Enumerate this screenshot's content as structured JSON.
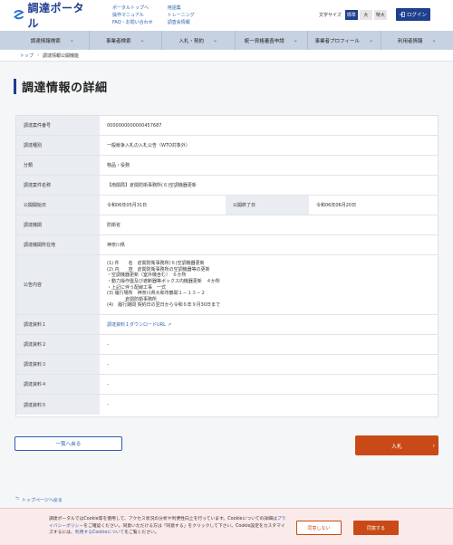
{
  "header": {
    "logo_text": "調達ポータル",
    "links_col1": [
      "ポータルトップへ",
      "操作マニュアル",
      "FAQ・お問い合わせ"
    ],
    "links_col2": [
      "用語集",
      "トレーニング",
      "調査会情報"
    ],
    "font_size_label": "文字サイズ",
    "font_sizes": [
      "標準",
      "大",
      "特大"
    ],
    "login_label": "ログイン"
  },
  "nav": {
    "items": [
      "調達情報検索",
      "事業者検索",
      "入札・契約",
      "統一資格審査申請",
      "事業者プロフィール",
      "利用者情報"
    ]
  },
  "breadcrumb": {
    "home": "トップ",
    "current": "調達情報公開機能"
  },
  "page_title": "調達情報の詳細",
  "detail": {
    "case_number_label": "調達案件番号",
    "case_number": "0000000000000457687",
    "type_label": "調達種別",
    "type": "一般競争入札の入札公告（WTO対象外）",
    "category_label": "分類",
    "category": "物品・役務",
    "name_label": "調達案件名称",
    "name": "【南関局】倉関防衛事務所(６)空調機器更新",
    "start_label": "公開開始日",
    "start": "令和06年05月31日",
    "end_label": "公開終了日",
    "end": "令和06年06月20日",
    "org_label": "調達機関",
    "org": "防衛省",
    "location_label": "調達機関所在地",
    "location": "神奈川県",
    "notice_label": "公告内容",
    "notice_lines": [
      "(1) 件　　名　倉関防衛事務所(６)空調機器更新",
      "(2) 内　　容　倉関防衛事務所の空調機器等の更新",
      "・空調機器更新（室外機含む）　６か所",
      "・動力操作盤及び遮断器等ボックス内機器更新　４か所",
      "・上記に伴う配線工事　一式",
      "(3) 履行場所　神奈川県大和市鶴間１－１３－２",
      "　　　　倉関防衛事務所",
      "(4)　履行期間 契約日の翌日から令和６年９月30日まで"
    ],
    "doc1_label": "調達資料１",
    "doc1": "調達資料１ダウンロードURL",
    "doc2_label": "調達資料２",
    "doc2": "-",
    "doc3_label": "調達資料３",
    "doc3": "-",
    "doc4_label": "調達資料４",
    "doc4": "-",
    "doc5_label": "調達資料５",
    "doc5": "-"
  },
  "buttons": {
    "back": "一覧へ戻る",
    "bid": "入札",
    "bid_arrow": "›",
    "top_link": "トップページへ戻る"
  },
  "cookie": {
    "text_1": "調達ポータルではCookie等を使用して、アクセス状況の分析や利便性向上を行っています。Cookieについての詳細は",
    "privacy_link": "プライバシーポリシー",
    "text_2": "をご確認ください。同意いただける方は「同意する」をクリックして下さい。Cookie設定をカスタマイズするには、",
    "settings_link": "利用するCookieについて",
    "text_3": "をご覧ください。",
    "deny": "同意しない",
    "accept": "同意する"
  },
  "colors": {
    "brand": "#1f3f8f",
    "accent": "#c94a16",
    "nav_bg": "#c6d2e1",
    "label_bg": "#e9ecf1"
  }
}
